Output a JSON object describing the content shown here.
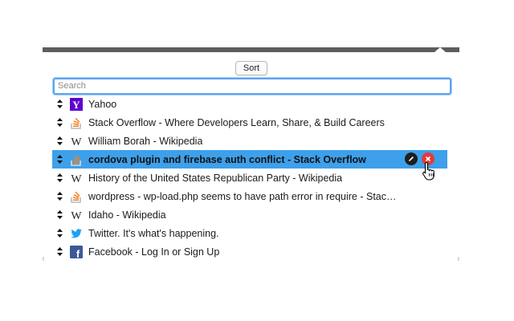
{
  "toolbar": {
    "sort_label": "Sort"
  },
  "search": {
    "placeholder": "Search"
  },
  "bookmarks": [
    {
      "title": "Yahoo",
      "icon": "yahoo-icon",
      "selected": false
    },
    {
      "title": "Stack Overflow - Where Developers Learn, Share, & Build Careers",
      "icon": "stackoverflow-icon",
      "selected": false
    },
    {
      "title": "William Borah - Wikipedia",
      "icon": "wikipedia-icon",
      "selected": false
    },
    {
      "title": "cordova plugin and firebase auth conflict - Stack Overflow",
      "icon": "stackoverflow-icon",
      "selected": true
    },
    {
      "title": "History of the United States Republican Party - Wikipedia",
      "icon": "wikipedia-icon",
      "selected": false
    },
    {
      "title": "wordpress - wp-load.php seems to have path error in require - Stac…",
      "icon": "stackoverflow-icon",
      "selected": false
    },
    {
      "title": "Idaho - Wikipedia",
      "icon": "wikipedia-icon",
      "selected": false
    },
    {
      "title": "Twitter. It's what's happening.",
      "icon": "twitter-icon",
      "selected": false
    },
    {
      "title": "Facebook - Log In or Sign Up",
      "icon": "facebook-icon",
      "selected": false
    }
  ],
  "colors": {
    "selection": "#3ea0ea",
    "focus_ring": "#5aa4f2",
    "remove_button": "#e23b3b",
    "edit_button": "#1e1e1e"
  }
}
